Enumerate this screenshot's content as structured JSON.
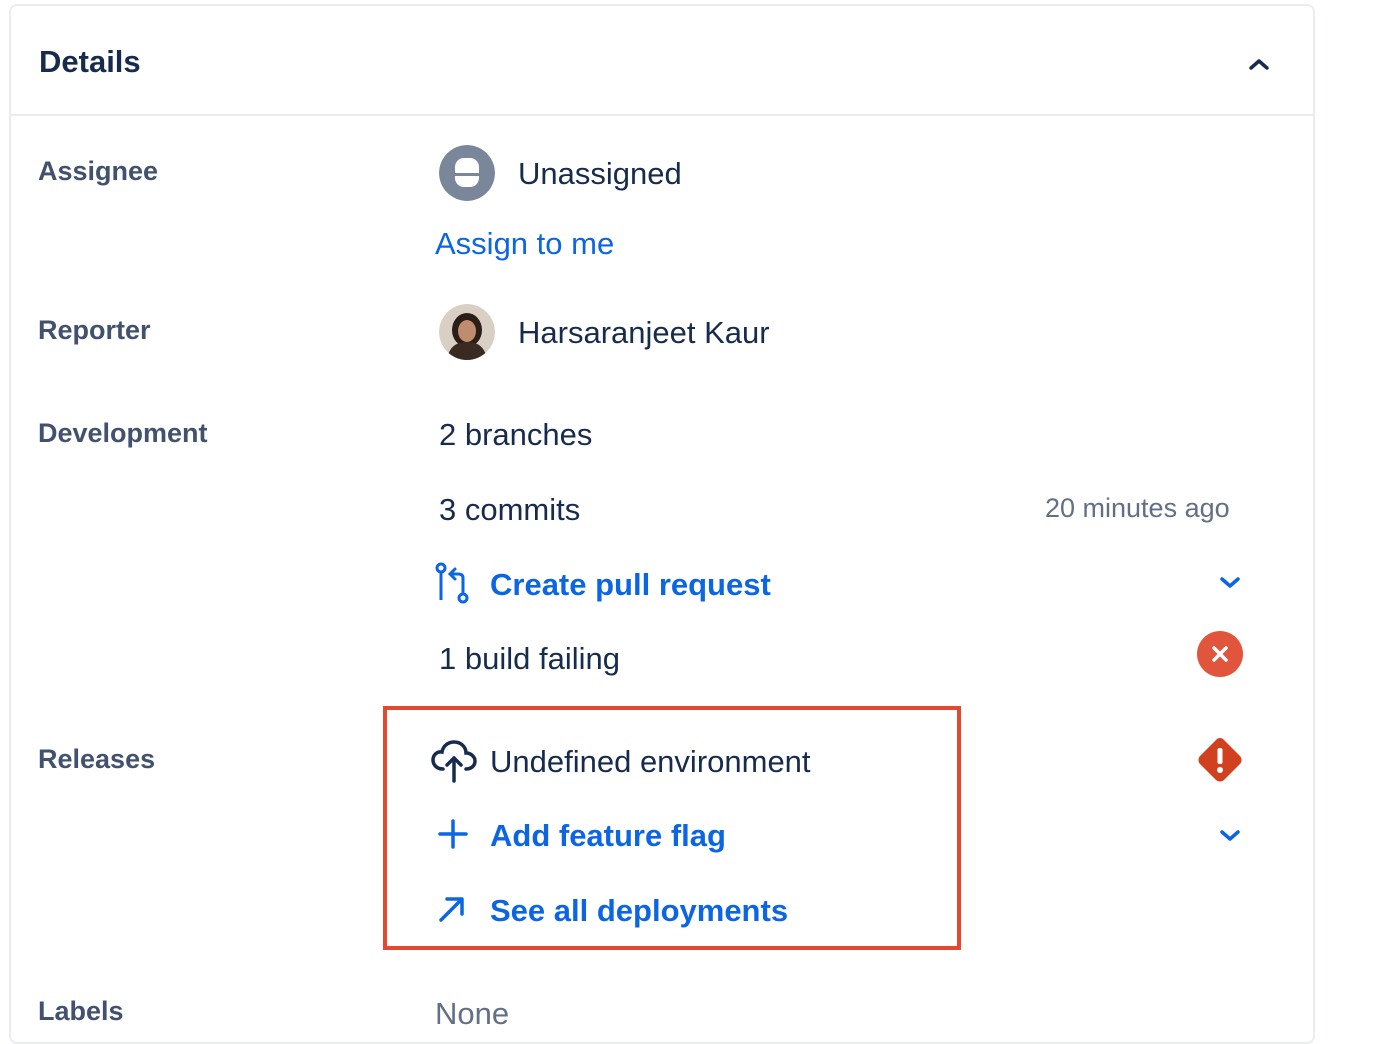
{
  "panel": {
    "title": "Details"
  },
  "fields": {
    "assignee": {
      "label": "Assignee",
      "value": "Unassigned",
      "assign_link": "Assign to me"
    },
    "reporter": {
      "label": "Reporter",
      "value": "Harsaranjeet Kaur"
    },
    "development": {
      "label": "Development",
      "branches": "2 branches",
      "commits": "3 commits",
      "commits_time": "20 minutes ago",
      "pull_request": "Create pull request",
      "build_status": "1 build failing"
    },
    "releases": {
      "label": "Releases",
      "environment": "Undefined environment",
      "add_flag": "Add feature flag",
      "see_deployments": "See all deployments"
    },
    "labels": {
      "label": "Labels",
      "value": "None"
    }
  },
  "icons": {
    "collapse": "chevron-up-icon",
    "assignee_avatar": "user-avatar-icon",
    "pull_request": "pull-request-icon",
    "build_failed": "error-circle-icon",
    "environment": "cloud-upload-icon",
    "environment_status": "warning-diamond-icon",
    "add": "plus-icon",
    "external": "arrow-up-right-icon",
    "dropdown": "chevron-down-icon"
  },
  "colors": {
    "link": "#0c66e4",
    "error": "#e2553d",
    "highlight": "#e2492f"
  }
}
